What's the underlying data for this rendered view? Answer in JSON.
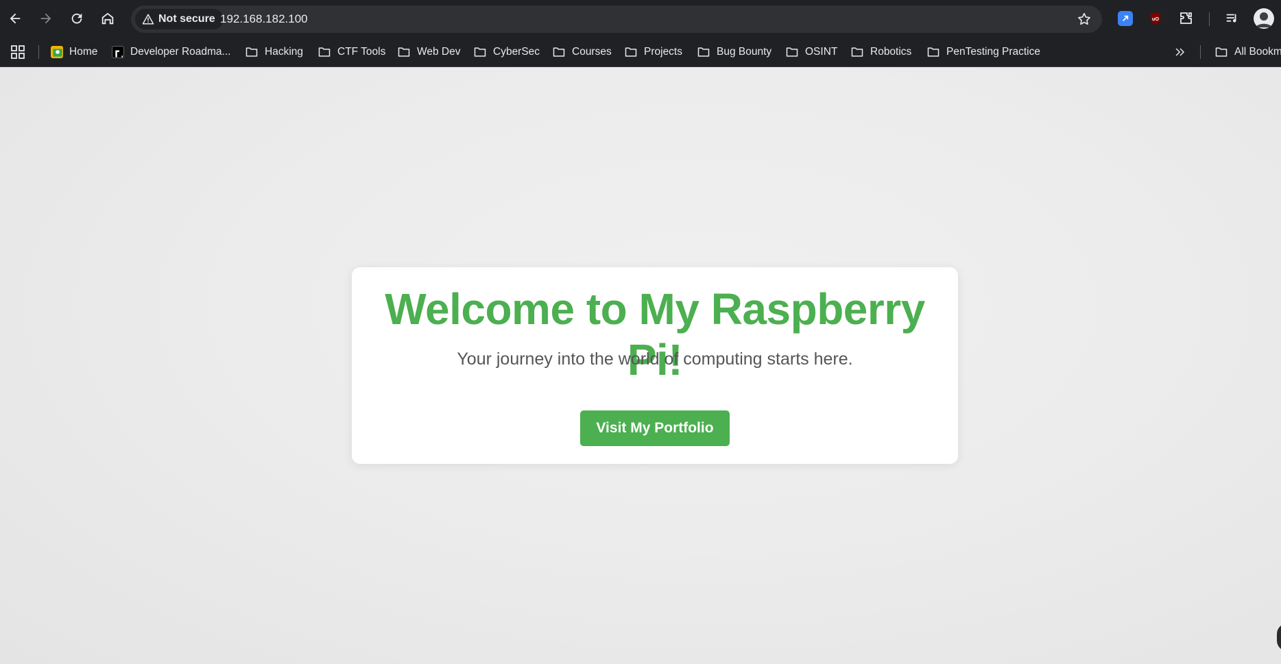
{
  "browser": {
    "security_label": "Not secure",
    "url": "192.168.182.100"
  },
  "bookmarks": {
    "items": [
      {
        "label": "Home",
        "icon": "home-favicon"
      },
      {
        "label": "Developer Roadma...",
        "icon": "roadmap-favicon"
      },
      {
        "label": "Hacking",
        "icon": "folder-icon"
      },
      {
        "label": "CTF Tools",
        "icon": "folder-icon"
      },
      {
        "label": "Web Dev",
        "icon": "folder-icon"
      },
      {
        "label": "CyberSec",
        "icon": "folder-icon"
      },
      {
        "label": "Courses",
        "icon": "folder-icon"
      },
      {
        "label": "Projects",
        "icon": "folder-icon"
      },
      {
        "label": "Bug Bounty",
        "icon": "folder-icon"
      },
      {
        "label": "OSINT",
        "icon": "folder-icon"
      },
      {
        "label": "Robotics",
        "icon": "folder-icon"
      },
      {
        "label": "PenTesting Practice",
        "icon": "folder-icon"
      }
    ],
    "all_bookmarks": "All Bookmarks"
  },
  "page": {
    "headline": "Welcome to My Raspberry Pi!",
    "tagline": "Your journey into the world of computing starts here.",
    "cta_label": "Visit My Portfolio"
  },
  "colors": {
    "accent": "#4caf50",
    "chrome": "#202124",
    "page_bg": "#ececec"
  }
}
